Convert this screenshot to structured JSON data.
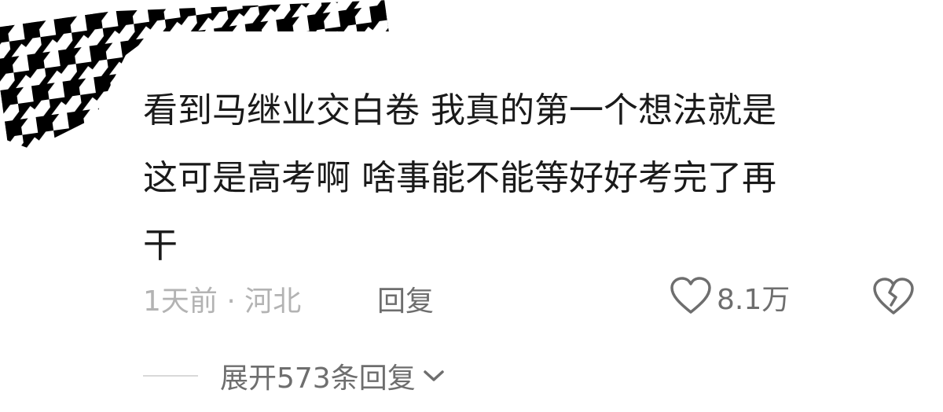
{
  "comment": {
    "avatar_icon": "houndstooth-pattern-avatar",
    "text_lines": [
      "看到马继业交白卷 我真的第一个想法就是",
      "这可是高考啊 啥事能不能等好好考完了再",
      "干"
    ],
    "meta": "1天前 · 河北",
    "reply_label": "回复",
    "like_icon": "heart-outline-icon",
    "like_count": "8.1万",
    "dislike_icon": "broken-heart-icon"
  },
  "replies": {
    "expand_label": "展开573条回复",
    "expand_icon": "chevron-down-icon"
  },
  "colors": {
    "body_text": "#1a1a1a",
    "meta_text": "#b3b3b3",
    "secondary_text": "#6e6e6e",
    "icon": "#6e6e6e",
    "divider": "#d9d9d9"
  }
}
